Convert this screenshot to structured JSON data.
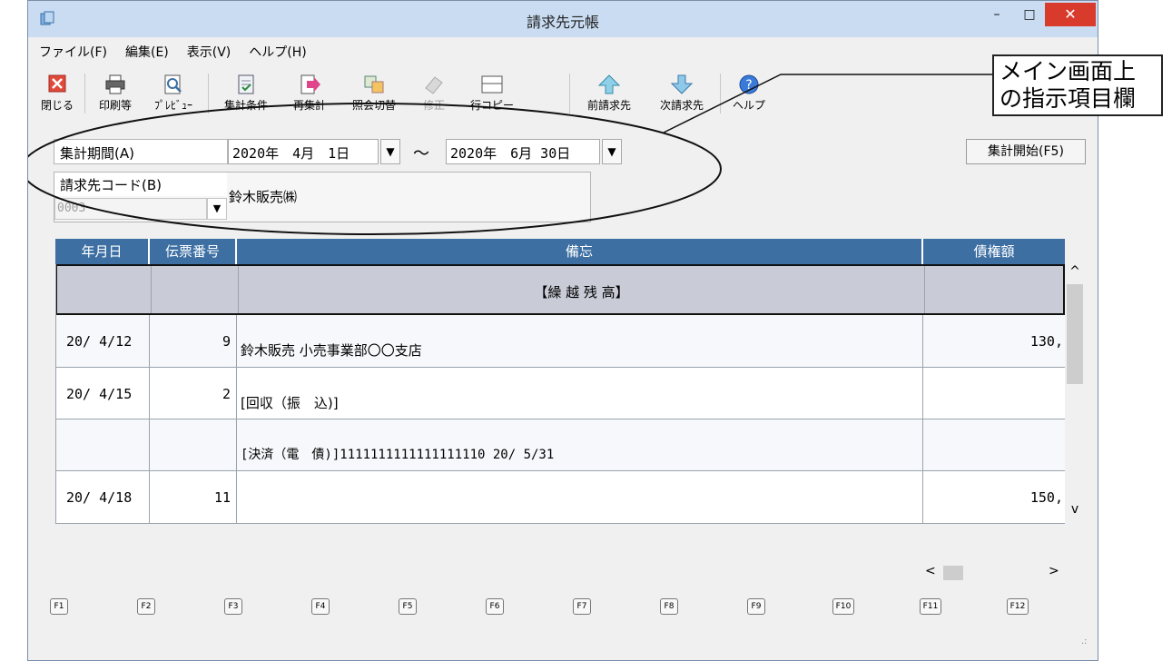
{
  "window": {
    "title": "請求先元帳",
    "min": "–",
    "max": "□",
    "close": "✕"
  },
  "menu": [
    "ファイル(F)",
    "編集(E)",
    "表示(V)",
    "ヘルプ(H)"
  ],
  "toolbar": {
    "close": "閉じる",
    "print": "印刷等",
    "preview": "ﾌﾟﾚﾋﾞｭｰ",
    "conditions": "集計条件",
    "recalc": "再集計",
    "switch": "照会切替",
    "edit": "修正",
    "copy": "行コピー",
    "prev": "前請求先",
    "next": "次請求先",
    "help": "ヘルプ"
  },
  "period": {
    "label": "集計期間(A)",
    "from": "2020年　4月　1日",
    "tilde": "～",
    "to": "2020年　6月 30日",
    "start_button": "集計開始(F5)"
  },
  "customer": {
    "label": "請求先コード(B)",
    "code": "0003",
    "name": "鈴木販売㈱"
  },
  "table": {
    "headers": [
      "年月日",
      "伝票番号",
      "備忘",
      "債権額"
    ],
    "carryover": "【繰 越 残 高】",
    "rows": [
      {
        "date": "20/ 4/12",
        "no": "9",
        "memo": "鈴木販売 小売事業部〇〇支店",
        "amount": "130,"
      },
      {
        "date": "20/ 4/15",
        "no": "2",
        "memo": "[回収（振　込)]",
        "amount": ""
      },
      {
        "date": "",
        "no": "",
        "memo": "[決済（電　債)]1111111111111111110 20/ 5/31",
        "amount": ""
      },
      {
        "date": "20/ 4/18",
        "no": "11",
        "memo": "",
        "amount": "150,"
      }
    ]
  },
  "scroll": {
    "up": "^",
    "down": "v",
    "left": "<",
    "right": ">"
  },
  "fkeys": [
    "F1",
    "F2",
    "F3",
    "F4",
    "F5",
    "F6",
    "F7",
    "F8",
    "F9",
    "F10",
    "F11",
    "F12"
  ],
  "callout": {
    "line1": "メイン画面上",
    "line2": "の指示項目欄"
  },
  "colors": {
    "header": "#3d6fa3",
    "title_bar": "#c9dcf2",
    "close_button": "#d83a2c"
  }
}
